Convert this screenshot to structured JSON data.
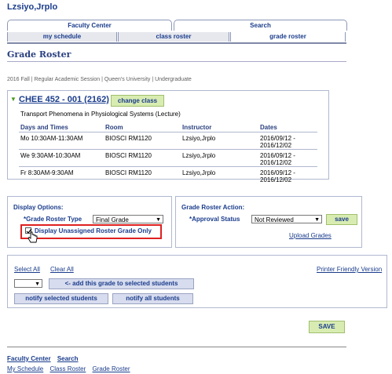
{
  "header": {
    "username": "Lzsiyo,Jrplo"
  },
  "tabs": {
    "level1": [
      "Faculty Center",
      "Search"
    ],
    "level2": [
      "my schedule",
      "class roster",
      "grade roster"
    ]
  },
  "page": {
    "title": "Grade Roster",
    "term_info": "2016 Fall | Regular Academic Session | Queen's University | Undergraduate"
  },
  "course": {
    "code": "CHEE 452 - 001 (2162)",
    "change_class_label": "change class",
    "description": "Transport Phenomena in Physiological Systems  (Lecture)",
    "headers": [
      "Days and Times",
      "Room",
      "Instructor",
      "Dates"
    ],
    "rows": [
      {
        "days": "Mo 10:30AM-11:30AM",
        "room": "BIOSCI RM1120",
        "instructor": "Lzsiyo,Jrplo",
        "dates1": "2016/09/12 -",
        "dates2": "2016/12/02"
      },
      {
        "days": "We 9:30AM-10:30AM",
        "room": "BIOSCI RM1120",
        "instructor": "Lzsiyo,Jrplo",
        "dates1": "2016/09/12 -",
        "dates2": "2016/12/02"
      },
      {
        "days": "Fr 8:30AM-9:30AM",
        "room": "BIOSCI RM1120",
        "instructor": "Lzsiyo,Jrplo",
        "dates1": "2016/09/12 -",
        "dates2": "2016/12/02"
      }
    ]
  },
  "display_options": {
    "title": "Display Options:",
    "roster_type_label": "*Grade Roster Type",
    "roster_type_value": "Final Grade",
    "unassigned_label": "Display Unassigned Roster Grade Only",
    "unassigned_checked": true
  },
  "roster_action": {
    "title": "Grade Roster Action:",
    "approval_label": "*Approval Status",
    "approval_value": "Not Reviewed",
    "save_label": "save",
    "upload_label": "Upload Grades"
  },
  "grade_actions": {
    "select_all": "Select All",
    "clear_all": "Clear All",
    "printer_friendly": "Printer Friendly Version",
    "grade_value": "",
    "add_grade_label": "<- add this grade to selected students",
    "notify_selected": "notify selected students",
    "notify_all": "notify all students"
  },
  "save_button_label": "SAVE",
  "footer": {
    "row1": [
      "Faculty Center",
      "Search"
    ],
    "row2": [
      "My Schedule",
      "Class Roster",
      "Grade Roster"
    ]
  },
  "colors": {
    "link": "#1a3c8c",
    "highlight": "#e02020",
    "green_button": "#d8ecb2",
    "blue_button": "#d7dcee"
  },
  "icons": {
    "expand": "triangle-down-icon",
    "pointer": "hand-pointer-icon"
  }
}
